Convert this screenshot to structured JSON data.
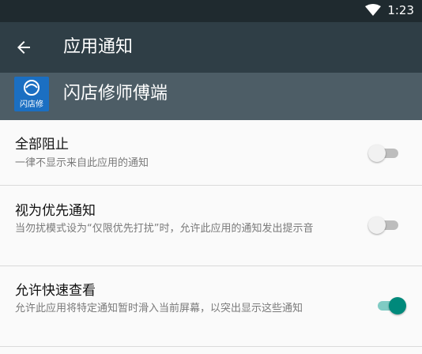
{
  "status_bar": {
    "time": "1:23"
  },
  "toolbar": {
    "title": "应用通知"
  },
  "app": {
    "name": "闪店修师傅端",
    "icon_text": "闪店修"
  },
  "settings": [
    {
      "title": "全部阻止",
      "subtitle": "一律不显示来自此应用的通知",
      "enabled": false
    },
    {
      "title": "视为优先通知",
      "subtitle": "当勿扰模式设为“仅限优先打扰”时，允许此应用的通知发出提示音",
      "enabled": false
    },
    {
      "title": "允许快速查看",
      "subtitle": "允许此应用将特定通知暂时滑入当前屏幕，以突出显示这些通知",
      "enabled": true
    }
  ],
  "colors": {
    "status_bar": "#1f2a2f",
    "toolbar": "#2f3e46",
    "app_row": "#4d5d66",
    "accent": "#00897b"
  }
}
